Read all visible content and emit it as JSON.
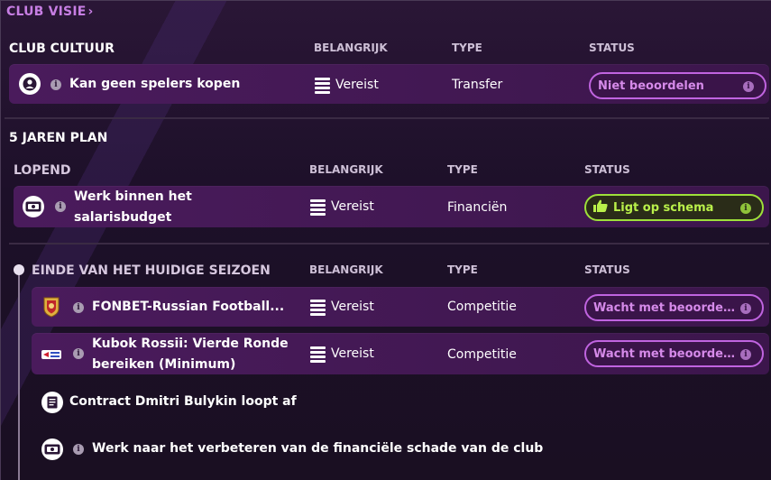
{
  "breadcrumb": {
    "label": "CLUB VISIE",
    "chevron": "›"
  },
  "columns": {
    "importance": "BELANGRIJK",
    "type": "TYPE",
    "status": "STATUS"
  },
  "club_culture": {
    "title": "CLUB CULTUUR",
    "rows": [
      {
        "name": "Kan geen spelers kopen",
        "importance": "Vereist",
        "type": "Transfer",
        "status": "Niet beoordelen",
        "icon": "person-icon"
      }
    ]
  },
  "five_year_plan": {
    "title": "5 JAREN PLAN",
    "ongoing": {
      "title": "LOPEND",
      "rows": [
        {
          "name_line1": "Werk binnen het",
          "name_line2": "salarisbudget",
          "importance": "Vereist",
          "type": "Financiën",
          "status": "Ligt op schema",
          "icon": "money-icon"
        }
      ]
    },
    "end_of_season": {
      "title": "EINDE VAN HET HUIDIGE SEIZOEN",
      "rows": [
        {
          "name": "FONBET-Russian Football...",
          "importance": "Vereist",
          "type": "Competitie",
          "status": "Wacht met beoordeli...",
          "icon": "league-badge-icon"
        },
        {
          "name_line1": "Kubok Rossii: Vierde Ronde",
          "name_line2": "bereiken (Minimum)",
          "importance": "Vereist",
          "type": "Competitie",
          "status": "Wacht met beoordeli...",
          "icon": "cup-badge-icon"
        }
      ],
      "plain_items": [
        {
          "name": "Contract Dmitri Bulykin loopt af",
          "icon": "contract-icon"
        },
        {
          "name": "Werk naar het verbeteren van de financiële schade van de club",
          "icon": "money-icon"
        }
      ]
    }
  },
  "colors": {
    "accent": "#c064e0",
    "ok": "#9ee03a",
    "row_bg": "#4a1b5c"
  }
}
